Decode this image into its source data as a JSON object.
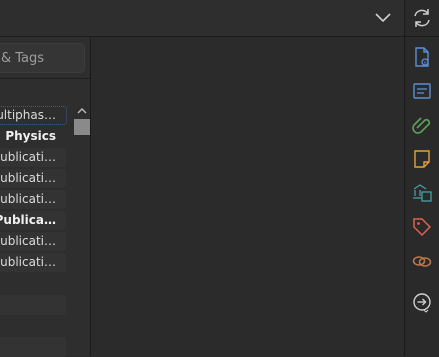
{
  "search": {
    "placeholder": "& Tags"
  },
  "collections": [
    {
      "label": "ultiphas…"
    },
    {
      "label": "Physics"
    },
    {
      "label": "Publicati…"
    },
    {
      "label": "Publicati…"
    },
    {
      "label": "Publicati…"
    },
    {
      "label": "Publica…"
    },
    {
      "label": "Publicati…"
    },
    {
      "label": "Publicati…"
    }
  ],
  "icons": {
    "sync": "sync-icon",
    "chevron": "chevron-down-icon",
    "info": "document-info-icon",
    "abstract": "abstract-icon",
    "attachments": "paperclip-icon",
    "notes": "note-icon",
    "libraries": "libraries-collections-icon",
    "tags": "tag-icon",
    "related": "related-link-icon",
    "locate": "locate-icon"
  },
  "colors": {
    "blue": "#5b8fd6",
    "green": "#5fa35a",
    "orange": "#e3a13a",
    "teal": "#4a9ea5",
    "red": "#d9644f",
    "brown": "#c27a4b"
  }
}
